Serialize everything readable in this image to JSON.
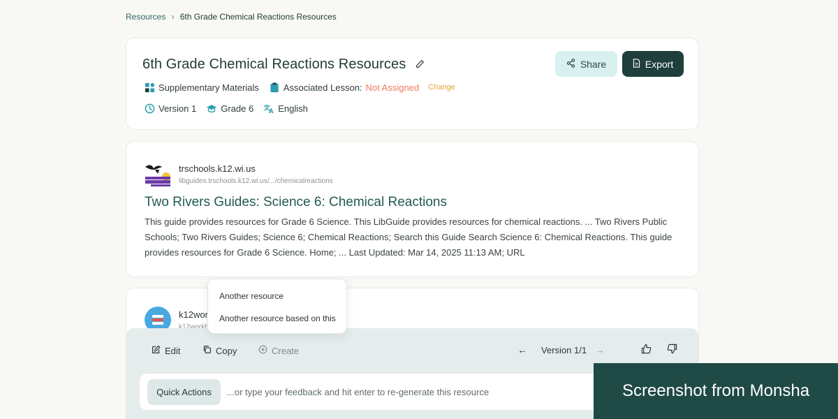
{
  "breadcrumb": {
    "root": "Resources",
    "separator": "›",
    "current": "6th Grade Chemical Reactions Resources"
  },
  "header": {
    "title": "6th Grade Chemical Reactions Resources",
    "type_label": "Supplementary Materials",
    "lesson_label": "Associated Lesson:",
    "lesson_value": "Not Assigned",
    "change_label": "Change",
    "version": "Version 1",
    "grade": "Grade 6",
    "language": "English",
    "share_label": "Share",
    "export_label": "Export"
  },
  "results": [
    {
      "domain": "trschools.k12.wi.us",
      "url": "libguides.trschools.k12.wi.us/.../chemicalreactions",
      "title": "Two Rivers Guides: Science 6: Chemical Reactions",
      "snippet": "This guide provides resources for Grade 6 Science. This LibGuide provides resources for chemical reactions. ... Two Rivers Public Schools; Two Rivers Guides; Science 6; Chemical Reactions; Search this Guide Search Science 6: Chemical Reactions. This guide provides resources for Grade 6 Science. Home; ... Last Updated: Mar 14, 2025 11:13 AM; URL"
    },
    {
      "domain": "k12work",
      "url": "k12workb"
    }
  ],
  "dropdown": {
    "items": [
      "Another resource",
      "Another resource based on this"
    ]
  },
  "action_bar": {
    "edit_label": "Edit",
    "copy_label": "Copy",
    "create_label": "Create",
    "prev_arrow": "←",
    "version_label": "Version 1/1",
    "next_arrow": "→",
    "quick_actions_label": "Quick Actions",
    "feedback_placeholder": "...or type your feedback and hit enter to re-generate this resource"
  },
  "watermark": "Screenshot from Monsha",
  "colors": {
    "primary_dark": "#1e3f3b",
    "accent_light": "#d8f1ef",
    "warning": "#f07a5a",
    "link_orange": "#e8a33a",
    "title_green": "#1f5a52"
  }
}
